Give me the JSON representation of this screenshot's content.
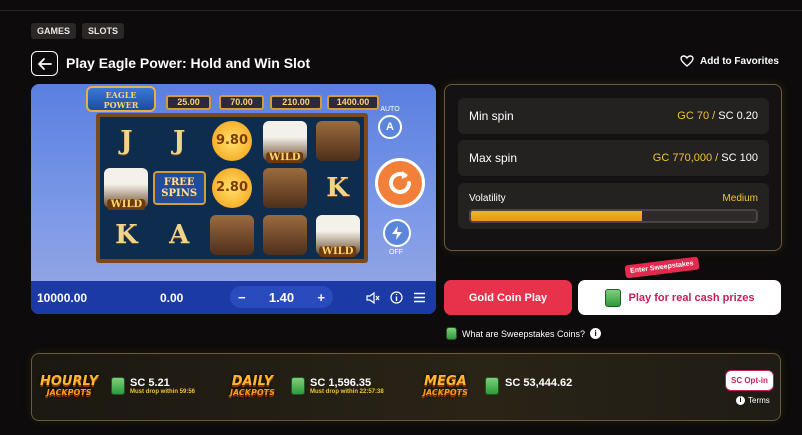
{
  "tags": [
    "GAMES",
    "SLOTS"
  ],
  "page_title": "Play Eagle Power: Hold and Win Slot",
  "favorites_label": "Add to Favorites",
  "game": {
    "logo_line1": "EAGLE",
    "logo_line2": "POWER",
    "jackpots": [
      "25.00",
      "70.00",
      "210.00",
      "1400.00"
    ],
    "reels": [
      [
        "J",
        "J",
        "9.80",
        "eagle-wild",
        "wolf"
      ],
      [
        "eagle-wild",
        "FREE SPINS",
        "2.80",
        "wolf",
        "K"
      ],
      [
        "K",
        "A",
        "boar",
        "wolf",
        "eagle-wild"
      ]
    ],
    "wild_label": "WILD",
    "auto_label": "AUTO",
    "auto_letter": "A",
    "off_label": "OFF",
    "balance": "10000.00",
    "win": "0.00",
    "stake": "1.40",
    "minus": "−",
    "plus": "+"
  },
  "info": {
    "min_spin_label": "Min spin",
    "min_gc": "GC 70",
    "min_sc": "SC 0.20",
    "max_spin_label": "Max spin",
    "max_gc": "GC 770,000",
    "max_sc": "SC 100",
    "slash": "/",
    "volatility_label": "Volatility",
    "volatility_value": "Medium",
    "volatility_level": 0.6
  },
  "buttons": {
    "gold": "Gold Coin Play",
    "real": "Play for real cash prizes",
    "enter_badge": "Enter Sweepstakes"
  },
  "sweeps_question": "What are Sweepstakes Coins?",
  "jackpots_bar": {
    "hourly": {
      "word1": "HOURLY",
      "word2": "JACKPOTS",
      "value": "SC 5.21",
      "note": "Must drop within 59:56"
    },
    "daily": {
      "word1": "DAILY",
      "word2": "JACKPOTS",
      "value": "SC 1,596.35",
      "note": "Must drop within 22:57:38"
    },
    "mega": {
      "word1": "MEGA",
      "word2": "JACKPOTS",
      "value": "SC 53,444.62"
    },
    "optin": "SC Opt-in",
    "terms": "Terms"
  },
  "colors": {
    "accent_red": "#e8314a",
    "gold": "#f2c532",
    "brand_pink": "#c41f5a"
  }
}
